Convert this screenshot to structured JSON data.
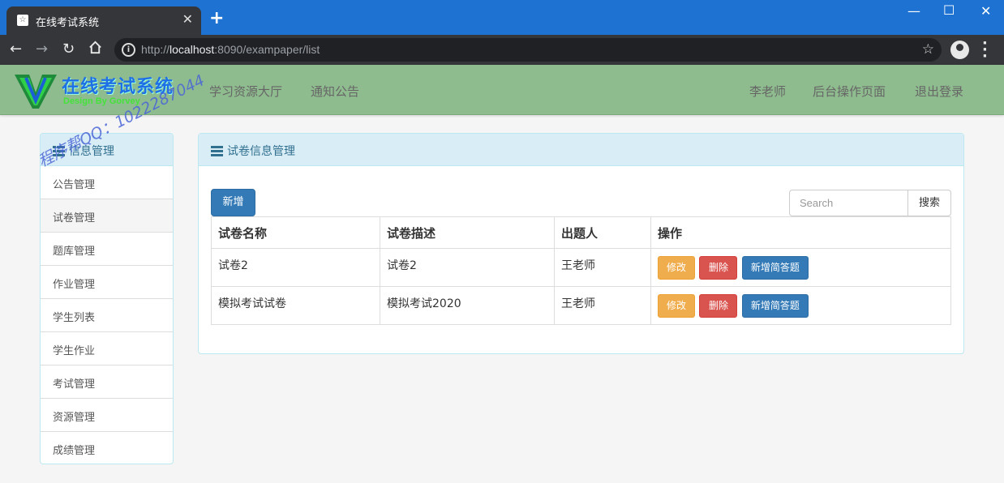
{
  "browser": {
    "tab_title": "在线考试系统",
    "tab_close": "✕",
    "new_tab": "+",
    "url_prefix": "http://",
    "url_host": "localhost",
    "url_path": ":8090/exampaper/list",
    "star": "☆",
    "info_icon": "i",
    "icons": [
      "back-icon",
      "forward-icon",
      "reload-icon",
      "home-icon",
      "star-icon",
      "profile-icon",
      "menu-icon"
    ]
  },
  "site": {
    "logo_title": "在线考试系统",
    "logo_subtitle": "Design By Gorvey",
    "nav_left": [
      "学习资源大厅",
      "通知公告"
    ],
    "nav_right": [
      "李老师",
      "后台操作页面",
      "退出登录"
    ],
    "watermark": "程序帮QQ：1022287044",
    "navbar_color": "#8fbc8f"
  },
  "sidebar": {
    "title": "信息管理",
    "items": [
      {
        "label": "公告管理"
      },
      {
        "label": "试卷管理"
      },
      {
        "label": "题库管理"
      },
      {
        "label": "作业管理"
      },
      {
        "label": "学生列表"
      },
      {
        "label": "学生作业"
      },
      {
        "label": "考试管理"
      },
      {
        "label": "资源管理"
      },
      {
        "label": "成绩管理"
      }
    ],
    "active_index": 1
  },
  "main": {
    "title": "试卷信息管理",
    "add_label": "新增",
    "search_placeholder": "Search",
    "search_label": "搜索",
    "columns": [
      "试卷名称",
      "试卷描述",
      "出题人",
      "操作"
    ],
    "rows": [
      {
        "name": "试卷2",
        "desc": "试卷2",
        "author": "王老师"
      },
      {
        "name": "模拟考试试卷",
        "desc": "模拟考试2020",
        "author": "王老师"
      }
    ],
    "actions": {
      "edit": "修改",
      "delete": "删除",
      "add_question": "新增简答题"
    },
    "colors": {
      "primary": "#337ab7",
      "warning": "#f0ad4e",
      "danger": "#d9534f",
      "panel_head": "#d9edf7"
    }
  }
}
